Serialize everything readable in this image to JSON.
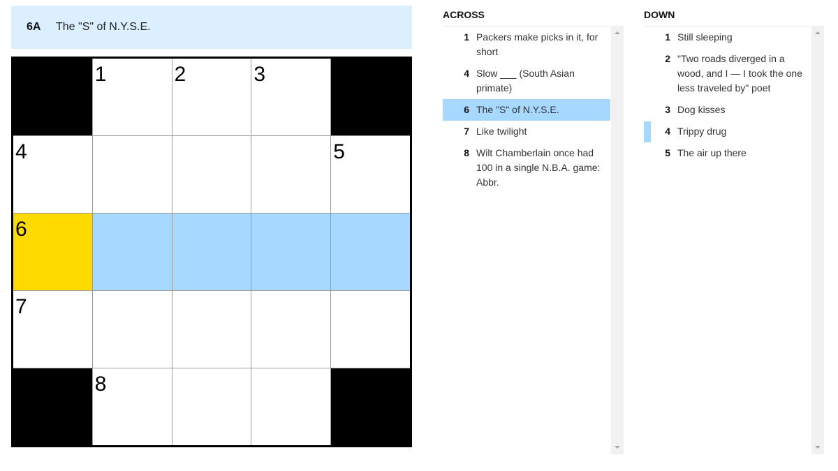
{
  "current_clue": {
    "label": "6A",
    "text": "The \"S\" of N.Y.S.E."
  },
  "colors": {
    "active_cell": "#ffda00",
    "active_word": "#a7d8ff",
    "clue_bar": "#dcefff",
    "block": "#000000"
  },
  "grid": {
    "rows": 5,
    "cols": 5,
    "cells": [
      [
        {
          "block": true
        },
        {
          "num": "1"
        },
        {
          "num": "2"
        },
        {
          "num": "3"
        },
        {
          "block": true
        }
      ],
      [
        {
          "num": "4"
        },
        {},
        {},
        {},
        {
          "num": "5"
        }
      ],
      [
        {
          "num": "6",
          "state": "active"
        },
        {
          "state": "word"
        },
        {
          "state": "word"
        },
        {
          "state": "word"
        },
        {
          "state": "word"
        }
      ],
      [
        {
          "num": "7"
        },
        {},
        {},
        {},
        {}
      ],
      [
        {
          "block": true
        },
        {
          "num": "8"
        },
        {},
        {},
        {
          "block": true
        }
      ]
    ]
  },
  "across": {
    "title": "ACROSS",
    "clues": [
      {
        "num": "1",
        "text": "Packers make picks in it, for short"
      },
      {
        "num": "4",
        "text": "Slow ___ (South Asian primate)"
      },
      {
        "num": "6",
        "text": "The \"S\" of N.Y.S.E.",
        "selected": true
      },
      {
        "num": "7",
        "text": "Like twilight"
      },
      {
        "num": "8",
        "text": "Wilt Chamberlain once had 100 in a single N.B.A. game: Abbr."
      }
    ]
  },
  "down": {
    "title": "DOWN",
    "clues": [
      {
        "num": "1",
        "text": "Still sleeping"
      },
      {
        "num": "2",
        "text": "\"Two roads diverged in a wood, and I — I took the one less traveled by\" poet"
      },
      {
        "num": "3",
        "text": "Dog kisses"
      },
      {
        "num": "4",
        "text": "Trippy drug",
        "crossing": true
      },
      {
        "num": "5",
        "text": "The air up there"
      }
    ]
  }
}
